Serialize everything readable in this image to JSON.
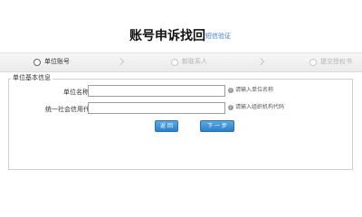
{
  "header": {
    "title": "账号申诉找回",
    "sms_link": "短信验证"
  },
  "steps": [
    {
      "label": "单位账号",
      "active": true
    },
    {
      "label": "新联系人",
      "active": false
    },
    {
      "label": "提交授权书",
      "active": false
    }
  ],
  "section": {
    "legend": "单位基本信息"
  },
  "form": {
    "unit_name_label": "单位名称：",
    "unit_name_value": "",
    "unit_name_hint": "请输入单位名称",
    "credit_code_label": "统一社会信用代码：",
    "credit_code_value": "",
    "credit_code_hint": "请输入组织机构代码",
    "hint_icon_glyph": "i"
  },
  "buttons": {
    "back_label": "返 回",
    "next_label": "下 一 步"
  },
  "colors": {
    "accent": "#3a7bd5",
    "button": "#3b8fd6"
  }
}
